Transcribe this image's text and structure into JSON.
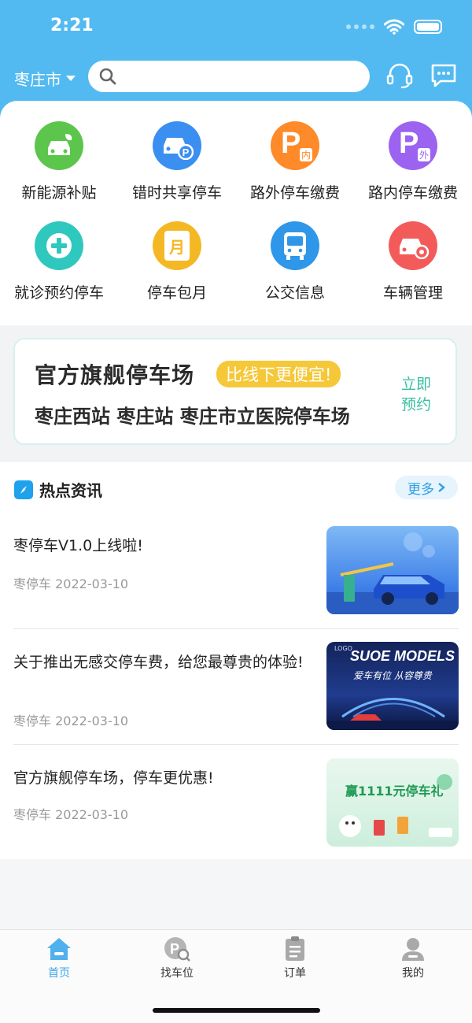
{
  "status": {
    "time": "2:21"
  },
  "header": {
    "city": "枣庄市",
    "search_placeholder": ""
  },
  "services": [
    {
      "label": "新能源补贴",
      "color": "#5bc64b",
      "icon": "car-leaf-icon"
    },
    {
      "label": "错时共享停车",
      "color": "#3a8ff0",
      "icon": "car-parking-icon"
    },
    {
      "label": "路外停车缴费",
      "color": "#ff8a2a",
      "icon": "parking-inside-icon",
      "glyph": "P",
      "sub": "内"
    },
    {
      "label": "路内停车缴费",
      "color": "#9b63f0",
      "icon": "parking-outside-icon",
      "glyph": "P",
      "sub": "外"
    },
    {
      "label": "就诊预约停车",
      "color": "#2fc8bf",
      "icon": "medical-cross-icon"
    },
    {
      "label": "停车包月",
      "color": "#f4b825",
      "icon": "monthly-pass-icon",
      "glyph": "月"
    },
    {
      "label": "公交信息",
      "color": "#2f97ea",
      "icon": "bus-icon"
    },
    {
      "label": "车辆管理",
      "color": "#f35b5b",
      "icon": "car-settings-icon"
    }
  ],
  "banner": {
    "title": "官方旗舰停车场",
    "tag": "比线下更便宜!",
    "subtitle": "枣庄西站 枣庄站 枣庄市立医院停车场",
    "action": "立即预约"
  },
  "news": {
    "title": "热点资讯",
    "more": "更多",
    "items": [
      {
        "title": "枣停车V1.0上线啦!",
        "source": "枣停车",
        "date": "2022-03-10"
      },
      {
        "title": "关于推出无感交停车费，给您最尊贵的体验!",
        "source": "枣停车",
        "date": "2022-03-10"
      },
      {
        "title": "官方旗舰停车场，停车更优惠!",
        "source": "枣停车",
        "date": "2022-03-10"
      }
    ],
    "thumb2": {
      "brand": "LOGO",
      "headline": "SUOE MODELS",
      "tagline": "爱车有位  从容尊贵"
    },
    "thumb3": {
      "headline": "赢1111元停车礼"
    }
  },
  "tabs": [
    {
      "label": "首页",
      "icon": "home-icon"
    },
    {
      "label": "找车位",
      "icon": "find-parking-icon"
    },
    {
      "label": "订单",
      "icon": "orders-icon"
    },
    {
      "label": "我的",
      "icon": "profile-icon"
    }
  ],
  "colors": {
    "header": "#52baf0",
    "accent": "#3aa6ea"
  }
}
